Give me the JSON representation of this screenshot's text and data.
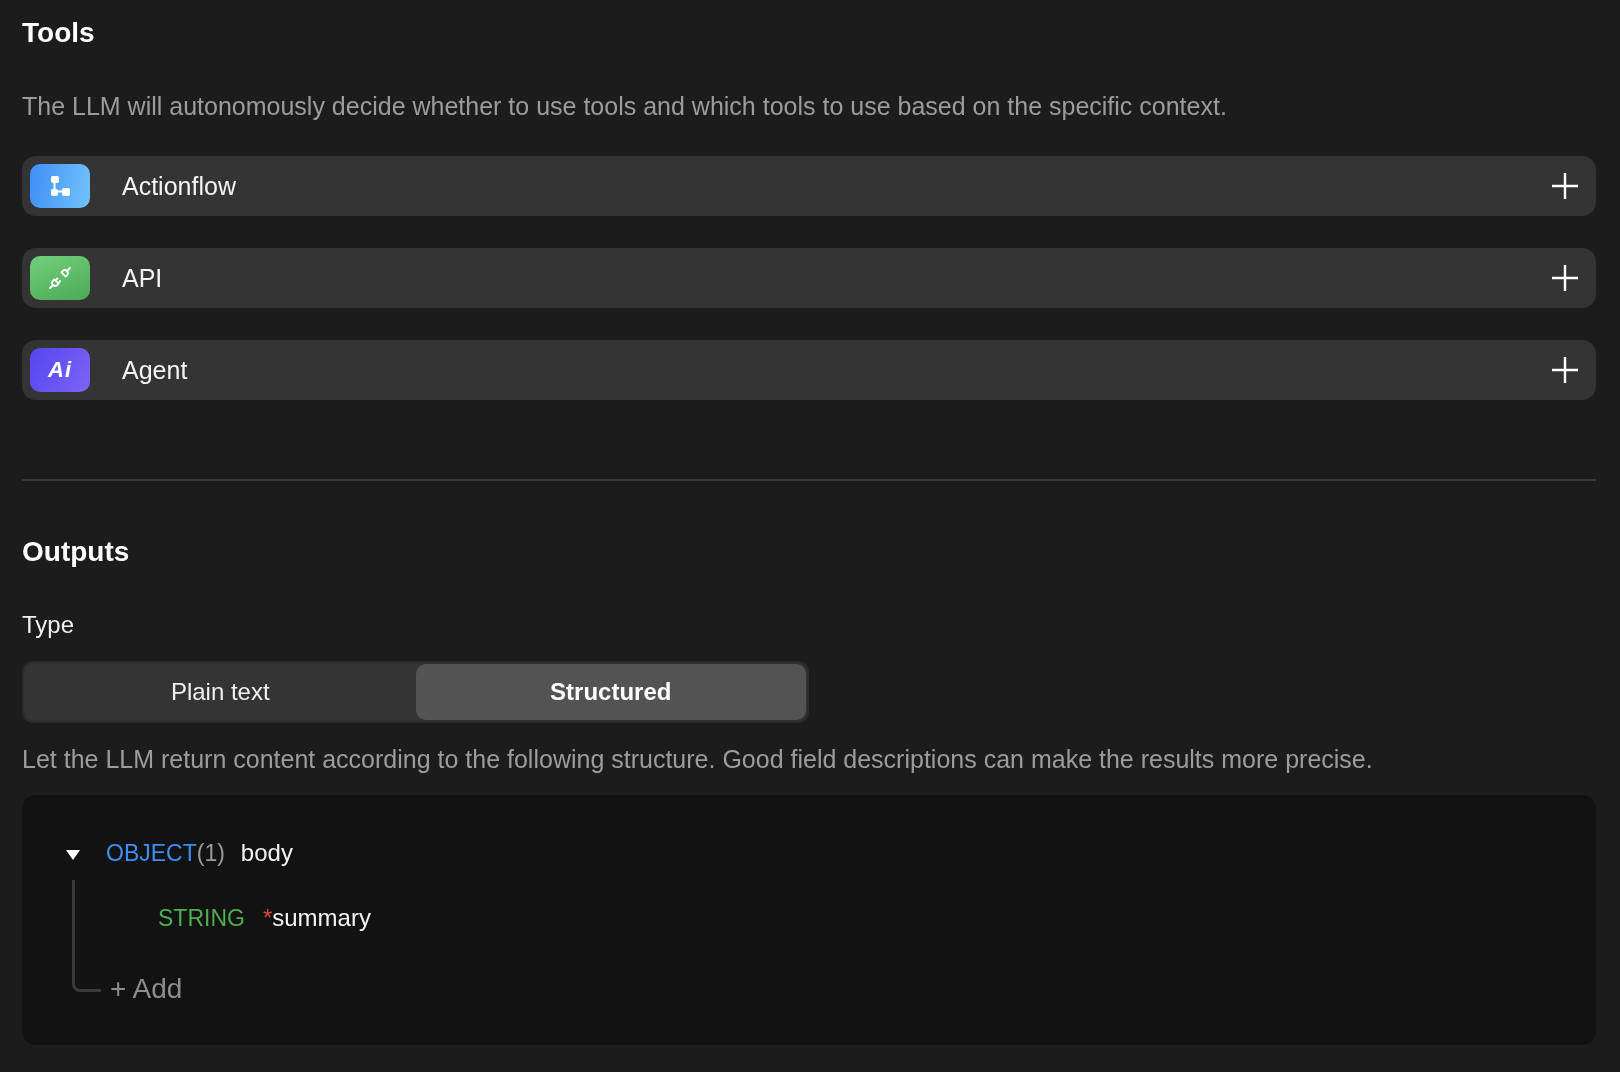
{
  "tools": {
    "title": "Tools",
    "description": "The LLM will autonomously decide whether to use tools and which tools to use based on the specific context.",
    "items": [
      {
        "kind": "flow",
        "label": "Actionflow"
      },
      {
        "kind": "plug",
        "label": "API"
      },
      {
        "kind": "ai",
        "icon_text": "Ai",
        "label": "Agent"
      }
    ]
  },
  "outputs": {
    "title": "Outputs",
    "type_label": "Type",
    "type_options": [
      {
        "label": "Plain text",
        "selected": false
      },
      {
        "label": "Structured",
        "selected": true
      }
    ],
    "help": "Let the LLM return content according to the following structure. Good field descriptions can make the results more precise.",
    "schema": {
      "root": {
        "kind": "object",
        "type": "OBJECT",
        "count": "(1)",
        "name": "body",
        "expanded": true,
        "children": [
          {
            "kind": "string",
            "type": "STRING",
            "required": true,
            "required_mark": "*",
            "name": "summary"
          }
        ]
      },
      "add_label": "+ Add"
    }
  }
}
